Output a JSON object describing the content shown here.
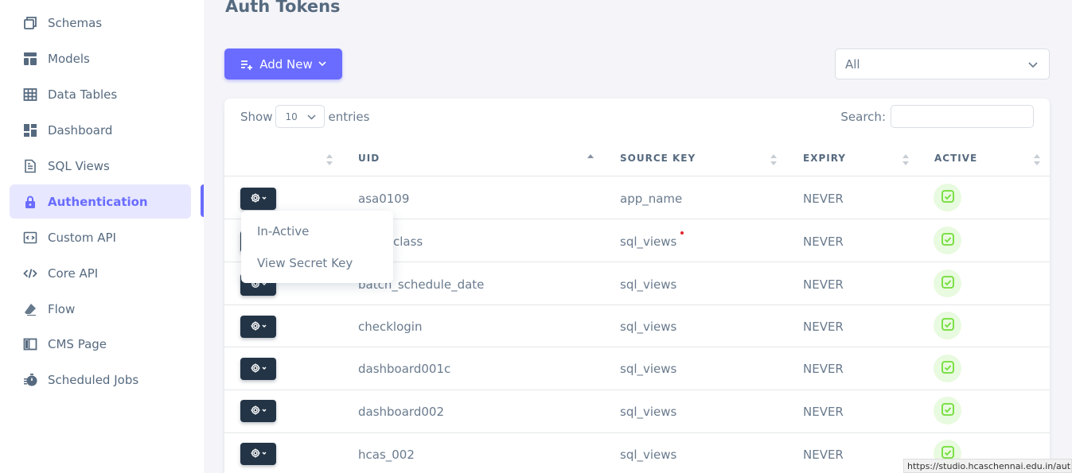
{
  "sidebar": {
    "items": [
      {
        "label": "Schemas",
        "icon": "copy-icon",
        "active": false
      },
      {
        "label": "Models",
        "icon": "layout-icon",
        "active": false
      },
      {
        "label": "Data Tables",
        "icon": "table-icon",
        "active": false
      },
      {
        "label": "Dashboard",
        "icon": "dashboard-icon",
        "active": false
      },
      {
        "label": "SQL Views",
        "icon": "file-icon",
        "active": false
      },
      {
        "label": "Authentication",
        "icon": "lock-icon",
        "active": true
      },
      {
        "label": "Custom API",
        "icon": "code-box-icon",
        "active": false
      },
      {
        "label": "Core API",
        "icon": "code-icon",
        "active": false
      },
      {
        "label": "Flow",
        "icon": "eraser-icon",
        "active": false
      },
      {
        "label": "CMS Page",
        "icon": "book-icon",
        "active": false
      },
      {
        "label": "Scheduled Jobs",
        "icon": "timer-icon",
        "active": false
      }
    ]
  },
  "page": {
    "title": "Auth Tokens",
    "add_new_label": "Add New",
    "filter_value": "All"
  },
  "table": {
    "show_label": "Show",
    "page_length": "10",
    "entries_label": "entries",
    "search_label": "Search:",
    "columns": [
      "UID",
      "SOURCE KEY",
      "EXPIRY",
      "ACTIVE"
    ],
    "rows": [
      {
        "uid": "asa0109",
        "source_key": "app_name",
        "expiry": "NEVER",
        "active": true
      },
      {
        "uid": "class",
        "source_key": "sql_views",
        "expiry": "NEVER",
        "active": true
      },
      {
        "uid": "batch_schedule_date",
        "source_key": "sql_views",
        "expiry": "NEVER",
        "active": true
      },
      {
        "uid": "checklogin",
        "source_key": "sql_views",
        "expiry": "NEVER",
        "active": true
      },
      {
        "uid": "dashboard001c",
        "source_key": "sql_views",
        "expiry": "NEVER",
        "active": true
      },
      {
        "uid": "dashboard002",
        "source_key": "sql_views",
        "expiry": "NEVER",
        "active": true
      },
      {
        "uid": "hcas_002",
        "source_key": "sql_views",
        "expiry": "NEVER",
        "active": true
      }
    ]
  },
  "dropdown": {
    "items": [
      "In-Active",
      "View Secret Key"
    ]
  },
  "status_url": "https://studio.hcaschennai.edu.in/auth",
  "colors": {
    "accent": "#696cff",
    "dark_button": "#233446",
    "success": "#71dd37"
  }
}
